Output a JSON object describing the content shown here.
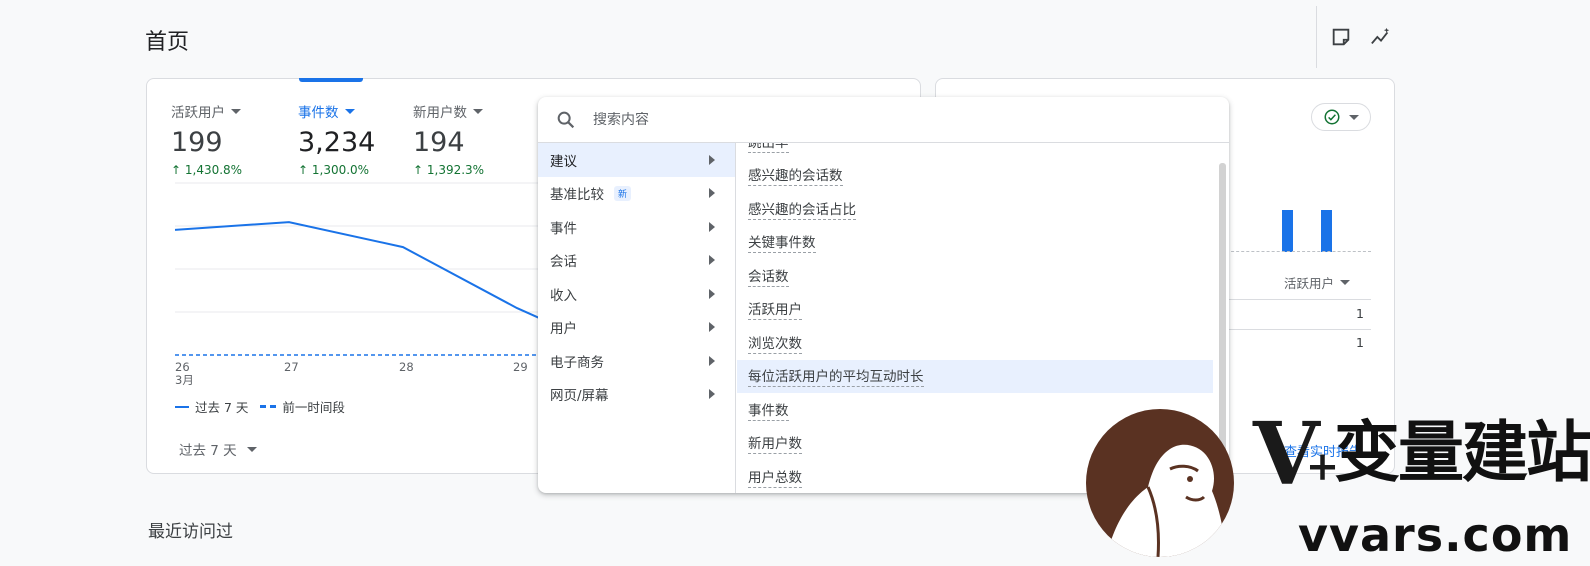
{
  "page": {
    "title": "首页",
    "recent_title": "最近访问过"
  },
  "top_icons": [
    {
      "name": "note-icon"
    },
    {
      "name": "insights-icon"
    }
  ],
  "metrics": [
    {
      "label": "活跃用户",
      "value": "199",
      "change": "↑ 1,430.8%",
      "active": false
    },
    {
      "label": "事件数",
      "value": "3,234",
      "change": "↑ 1,300.0%",
      "active": true
    },
    {
      "label": "新用户数",
      "value": "194",
      "change": "↑ 1,392.3%",
      "active": false
    }
  ],
  "chart_data": {
    "type": "line",
    "categories": [
      "26",
      "27",
      "28",
      "29"
    ],
    "x_tick_month": "3月",
    "series": [
      {
        "name": "过去 7 天",
        "values": [
          800,
          850,
          690,
          300
        ],
        "style": "solid"
      },
      {
        "name": "前一时间段",
        "values": [
          0,
          0,
          0,
          0
        ],
        "style": "dashed"
      }
    ],
    "ylim": [
      0,
      1100
    ],
    "grid": true,
    "legend_position": "bottom-left",
    "colors": {
      "series": "#1a73e8"
    }
  },
  "period_select": {
    "label": "过去 7 天"
  },
  "realtime": {
    "dimension_label": "活跃用户",
    "rows": [
      "1",
      "1"
    ],
    "link_text": "查看实时报告"
  },
  "dropdown": {
    "search_placeholder": "搜索内容",
    "categories": [
      {
        "label": "建议",
        "selected": true,
        "badge": ""
      },
      {
        "label": "基准比较",
        "selected": false,
        "badge": "新"
      },
      {
        "label": "事件",
        "selected": false,
        "badge": ""
      },
      {
        "label": "会话",
        "selected": false,
        "badge": ""
      },
      {
        "label": "收入",
        "selected": false,
        "badge": ""
      },
      {
        "label": "用户",
        "selected": false,
        "badge": ""
      },
      {
        "label": "电子商务",
        "selected": false,
        "badge": ""
      },
      {
        "label": "网页/屏幕",
        "selected": false,
        "badge": ""
      }
    ],
    "items": [
      {
        "label": "跳出率",
        "highlighted": false
      },
      {
        "label": "感兴趣的会话数",
        "highlighted": false
      },
      {
        "label": "感兴趣的会话占比",
        "highlighted": false
      },
      {
        "label": "关键事件数",
        "highlighted": false
      },
      {
        "label": "会话数",
        "highlighted": false
      },
      {
        "label": "活跃用户",
        "highlighted": false
      },
      {
        "label": "浏览次数",
        "highlighted": false
      },
      {
        "label": "每位活跃用户的平均互动时长",
        "highlighted": true
      },
      {
        "label": "事件数",
        "highlighted": false
      },
      {
        "label": "新用户数",
        "highlighted": false
      },
      {
        "label": "用户总数",
        "highlighted": false
      }
    ]
  },
  "watermark": {
    "letter": "V",
    "plus": "+",
    "brand": "变量建站",
    "url": "vvars.com"
  }
}
